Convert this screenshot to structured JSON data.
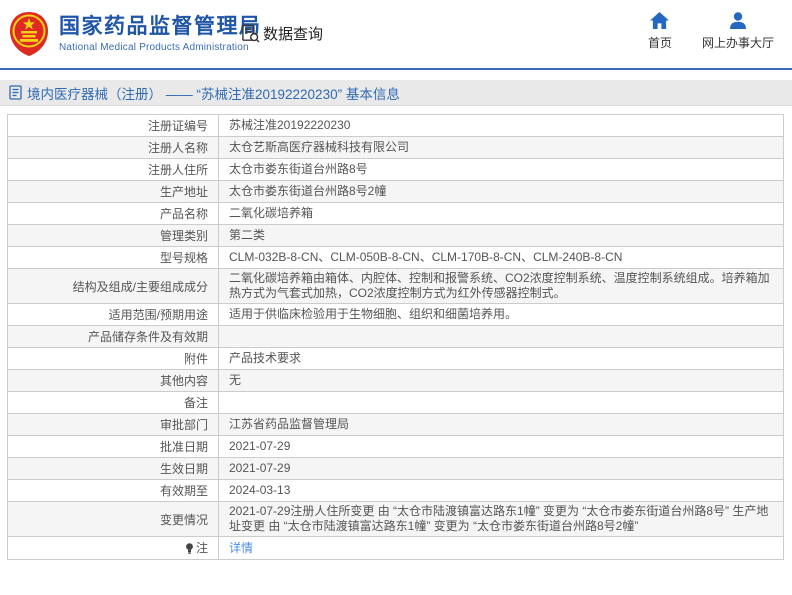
{
  "header": {
    "title": "国家药品监督管理局",
    "subtitle": "National Medical Products Administration",
    "data_query_label": "数据查询",
    "nav_home_label": "首页",
    "nav_hall_label": "网上办事大厅"
  },
  "title_bar": {
    "text": "境内医疗器械（注册） —— “苏械注准20192220230” 基本信息"
  },
  "table": {
    "rows": [
      {
        "label": "注册证编号",
        "value": "苏械注准20192220230"
      },
      {
        "label": "注册人名称",
        "value": "太仓艺斯高医疗器械科技有限公司"
      },
      {
        "label": "注册人住所",
        "value": "太仓市娄东街道台州路8号"
      },
      {
        "label": "生产地址",
        "value": "太仓市娄东街道台州路8号2幢"
      },
      {
        "label": "产品名称",
        "value": "二氧化碳培养箱"
      },
      {
        "label": "管理类别",
        "value": "第二类"
      },
      {
        "label": "型号规格",
        "value": "CLM-032B-8-CN、CLM-050B-8-CN、CLM-170B-8-CN、CLM-240B-8-CN"
      },
      {
        "label": "结构及组成/主要组成成分",
        "value": "二氧化碳培养箱由箱体、内腔体、控制和报警系统、CO2浓度控制系统、温度控制系统组成。培养箱加热方式为气套式加热，CO2浓度控制方式为红外传感器控制式。"
      },
      {
        "label": "适用范围/预期用途",
        "value": "适用于供临床检验用于生物细胞、组织和细菌培养用。"
      },
      {
        "label": "产品储存条件及有效期",
        "value": ""
      },
      {
        "label": "附件",
        "value": "产品技术要求"
      },
      {
        "label": "其他内容",
        "value": "无"
      },
      {
        "label": "备注",
        "value": ""
      },
      {
        "label": "审批部门",
        "value": "江苏省药品监督管理局"
      },
      {
        "label": "批准日期",
        "value": "2021-07-29"
      },
      {
        "label": "生效日期",
        "value": "2021-07-29"
      },
      {
        "label": "有效期至",
        "value": "2024-03-13"
      },
      {
        "label": "变更情况",
        "value": "2021-07-29注册人住所变更 由 “太仓市陆渡镇富达路东1幢” 变更为 “太仓市娄东街道台州路8号” 生产地址变更 由 “太仓市陆渡镇富达路东1幢” 变更为 “太仓市娄东街道台州路8号2幢”"
      },
      {
        "label": "注",
        "value": "详情",
        "link": true,
        "label_icon": "bulb-icon"
      }
    ]
  },
  "colors": {
    "brand_blue": "#1f56a7",
    "subtitle_blue": "#3a6db5",
    "emblem_red": "#dd2a22",
    "emblem_gold": "#f7d117",
    "icon_blue": "#2468c0",
    "title_bar_bg": "#e9e9e9",
    "title_bar_text": "#2f6bb3",
    "row_alt_bg": "#f5f5f5",
    "table_border": "#cccccc",
    "link_blue": "#4a90e2",
    "text_gray": "#555555"
  }
}
